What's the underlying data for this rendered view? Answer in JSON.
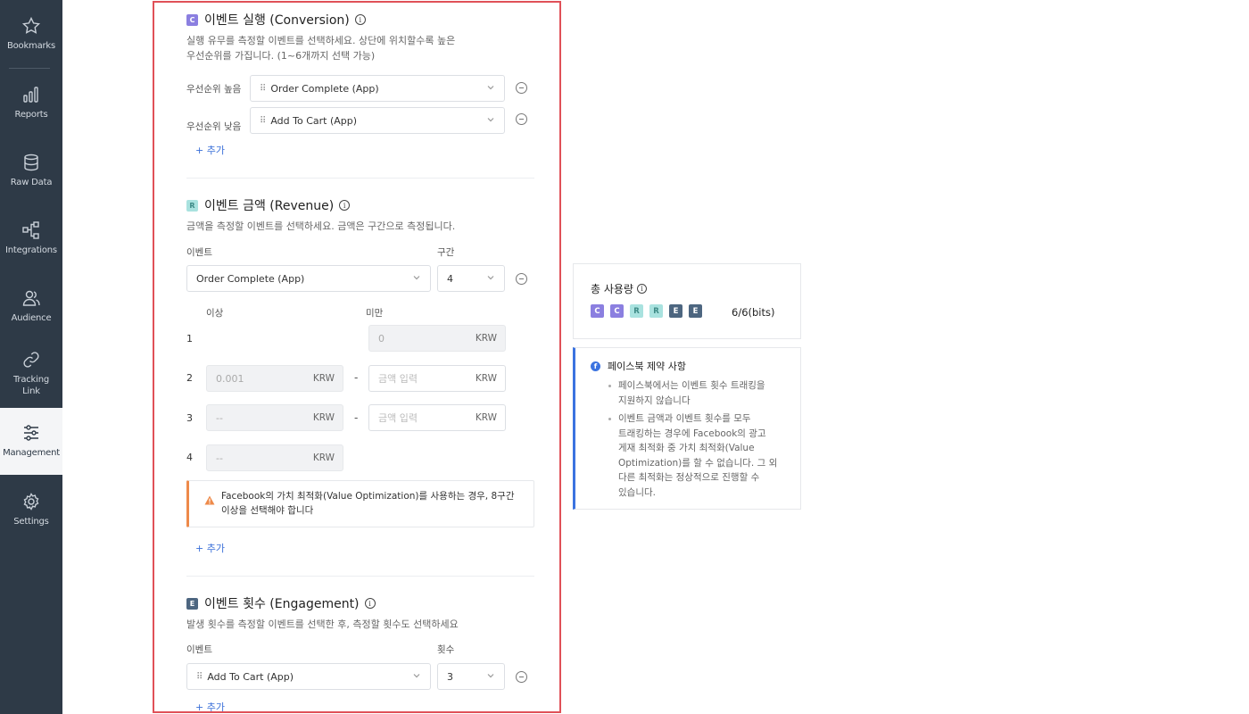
{
  "sidebar": {
    "items": [
      {
        "label": "Bookmarks",
        "icon": "star-icon"
      },
      {
        "label": "Reports",
        "icon": "bar-chart-icon"
      },
      {
        "label": "Raw Data",
        "icon": "database-icon"
      },
      {
        "label": "Integrations",
        "icon": "integration-icon"
      },
      {
        "label": "Audience",
        "icon": "users-icon"
      },
      {
        "label": "Tracking\nLink",
        "icon": "link-icon"
      },
      {
        "label": "Management",
        "icon": "sliders-icon",
        "active": true
      },
      {
        "label": "Settings",
        "icon": "gear-icon"
      }
    ]
  },
  "conversion": {
    "badge": "C",
    "title": "이벤트 실행 (Conversion)",
    "desc_line1": "실행 유무를 측정할 이벤트를 선택하세요. 상단에 위치할수록 높은",
    "desc_line2": "우선순위를 가집니다. (1~6개까지 선택 가능)",
    "rows": [
      {
        "priority_label": "우선순위 높음",
        "event": "Order Complete (App)"
      },
      {
        "priority_label": "우선순위 낮음",
        "event": "Add To Cart (App)"
      }
    ],
    "add_label": "+ 추가"
  },
  "revenue": {
    "badge": "R",
    "title": "이벤트 금액 (Revenue)",
    "desc": "금액을 측정할 이벤트를 선택하세요. 금액은 구간으로 측정됩니다.",
    "event_label": "이벤트",
    "bucket_label": "구간",
    "event_value": "Order Complete (App)",
    "bucket_value": "4",
    "min_label": "이상",
    "max_label": "미만",
    "unit": "KRW",
    "ranges": [
      {
        "num": "1",
        "max": "0"
      },
      {
        "num": "2",
        "min": "0.001",
        "max_placeholder": "금액 입력"
      },
      {
        "num": "3",
        "min": "--",
        "max_placeholder": "금액 입력"
      },
      {
        "num": "4",
        "min": "--"
      }
    ],
    "range_dash": "-",
    "warning_line1": "Facebook의 가치 최적화(Value Optimization)를 사용하는 경우, 8구간",
    "warning_line2": "이상을 선택해야 합니다",
    "add_label": "+ 추가"
  },
  "engagement": {
    "badge": "E",
    "title": "이벤트 횟수 (Engagement)",
    "desc": "발생 횟수를 측정할 이벤트를 선택한 후, 측정할 횟수도 선택하세요",
    "event_label": "이벤트",
    "count_label": "횟수",
    "event_value": "Add To Cart (App)",
    "count_value": "3",
    "add_label": "+ 추가"
  },
  "usage": {
    "title": "총 사용량",
    "bits": [
      "C",
      "C",
      "R",
      "R",
      "E",
      "E"
    ],
    "count": "6/6(bits)"
  },
  "facebook": {
    "title": "페이스북 제약 사항",
    "notes": [
      "페이스북에서는 이벤트 횟수 트래킹을\n지원하지 않습니다",
      "이벤트 금액과 이벤트 횟수를 모두\n트래킹하는 경우에 Facebook의 광고\n게재 최적화 중 가치 최적화(Value\nOptimization)를 할 수 없습니다. 그 외\n다른 최적화는 정상적으로 진행할 수\n있습니다."
    ]
  },
  "colors": {
    "sidebar_bg": "#2e3a47",
    "highlight_border": "#e05158",
    "conversion": "#8b7fe0",
    "revenue": "#a9e2df",
    "engagement": "#4d6680",
    "link": "#3a6fd8",
    "warning": "#ee8a4a",
    "facebook": "#3b73e0"
  }
}
